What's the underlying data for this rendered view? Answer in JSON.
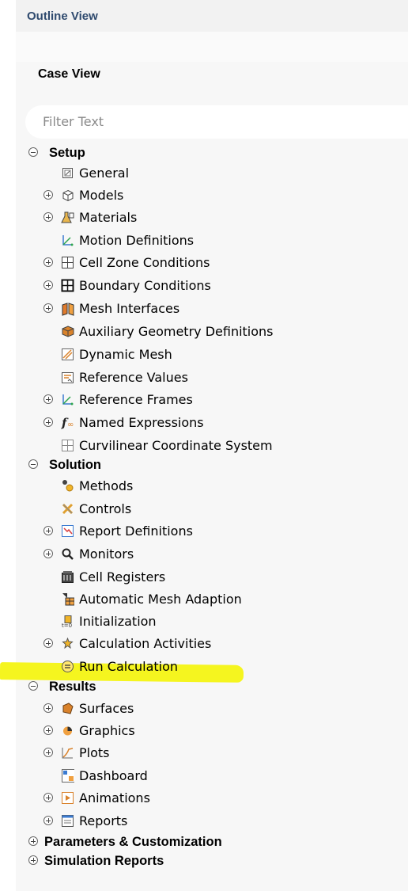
{
  "outline": {
    "title": "Outline View",
    "case_view": "Case View",
    "filter_placeholder": "Filter Text"
  },
  "tree": [
    {
      "label": "Setup",
      "level": 0,
      "expander": "minus",
      "icon": null
    },
    {
      "label": "General",
      "level": 1,
      "expander": null,
      "icon": "general-icon"
    },
    {
      "label": "Models",
      "level": 1,
      "expander": "plus",
      "icon": "models-icon"
    },
    {
      "label": "Materials",
      "level": 1,
      "expander": "plus",
      "icon": "materials-icon"
    },
    {
      "label": "Motion Definitions",
      "level": 1,
      "expander": null,
      "icon": "motion-definitions-icon"
    },
    {
      "label": "Cell Zone Conditions",
      "level": 1,
      "expander": "plus",
      "icon": "cell-zone-conditions-icon"
    },
    {
      "label": "Boundary Conditions",
      "level": 1,
      "expander": "plus",
      "icon": "boundary-conditions-icon"
    },
    {
      "label": "Mesh Interfaces",
      "level": 1,
      "expander": "plus",
      "icon": "mesh-interfaces-icon"
    },
    {
      "label": "Auxiliary Geometry Definitions",
      "level": 1,
      "expander": null,
      "icon": "auxiliary-geometry-icon"
    },
    {
      "label": "Dynamic Mesh",
      "level": 1,
      "expander": null,
      "icon": "dynamic-mesh-icon"
    },
    {
      "label": "Reference Values",
      "level": 1,
      "expander": null,
      "icon": "reference-values-icon"
    },
    {
      "label": "Reference Frames",
      "level": 1,
      "expander": "plus",
      "icon": "reference-frames-icon"
    },
    {
      "label": "Named Expressions",
      "level": 1,
      "expander": "plus",
      "icon": "named-expressions-icon"
    },
    {
      "label": "Curvilinear Coordinate System",
      "level": 1,
      "expander": null,
      "icon": "curvilinear-coordinate-icon"
    },
    {
      "label": "Solution",
      "level": 0,
      "expander": "minus",
      "icon": null
    },
    {
      "label": "Methods",
      "level": 1,
      "expander": null,
      "icon": "methods-icon"
    },
    {
      "label": "Controls",
      "level": 1,
      "expander": null,
      "icon": "controls-icon"
    },
    {
      "label": "Report Definitions",
      "level": 1,
      "expander": "plus",
      "icon": "report-definitions-icon"
    },
    {
      "label": "Monitors",
      "level": 1,
      "expander": "plus",
      "icon": "monitors-icon"
    },
    {
      "label": "Cell Registers",
      "level": 1,
      "expander": null,
      "icon": "cell-registers-icon"
    },
    {
      "label": "Automatic Mesh Adaption",
      "level": 1,
      "expander": null,
      "icon": "mesh-adaption-icon"
    },
    {
      "label": "Initialization",
      "level": 1,
      "expander": null,
      "icon": "initialization-icon"
    },
    {
      "label": "Calculation Activities",
      "level": 1,
      "expander": "plus",
      "icon": "calculation-activities-icon"
    },
    {
      "label": "Run Calculation",
      "level": 1,
      "expander": null,
      "icon": "run-calculation-icon"
    },
    {
      "label": "Results",
      "level": 0,
      "expander": "minus",
      "icon": null
    },
    {
      "label": "Surfaces",
      "level": 1,
      "expander": "plus",
      "icon": "surfaces-icon"
    },
    {
      "label": "Graphics",
      "level": 1,
      "expander": "plus",
      "icon": "graphics-icon"
    },
    {
      "label": "Plots",
      "level": 1,
      "expander": "plus",
      "icon": "plots-icon"
    },
    {
      "label": "Dashboard",
      "level": 1,
      "expander": null,
      "icon": "dashboard-icon"
    },
    {
      "label": "Animations",
      "level": 1,
      "expander": "plus",
      "icon": "animations-icon"
    },
    {
      "label": "Reports",
      "level": 1,
      "expander": "plus",
      "icon": "reports-icon"
    },
    {
      "label": "Parameters & Customization",
      "level": 0,
      "expander": "plus",
      "icon": null
    },
    {
      "label": "Simulation Reports",
      "level": 0,
      "expander": "plus",
      "icon": null
    }
  ],
  "colors": {
    "header_text": "#2f4a6e",
    "highlight": "#f5f51f",
    "panel_bg": "#f7f7f7"
  }
}
